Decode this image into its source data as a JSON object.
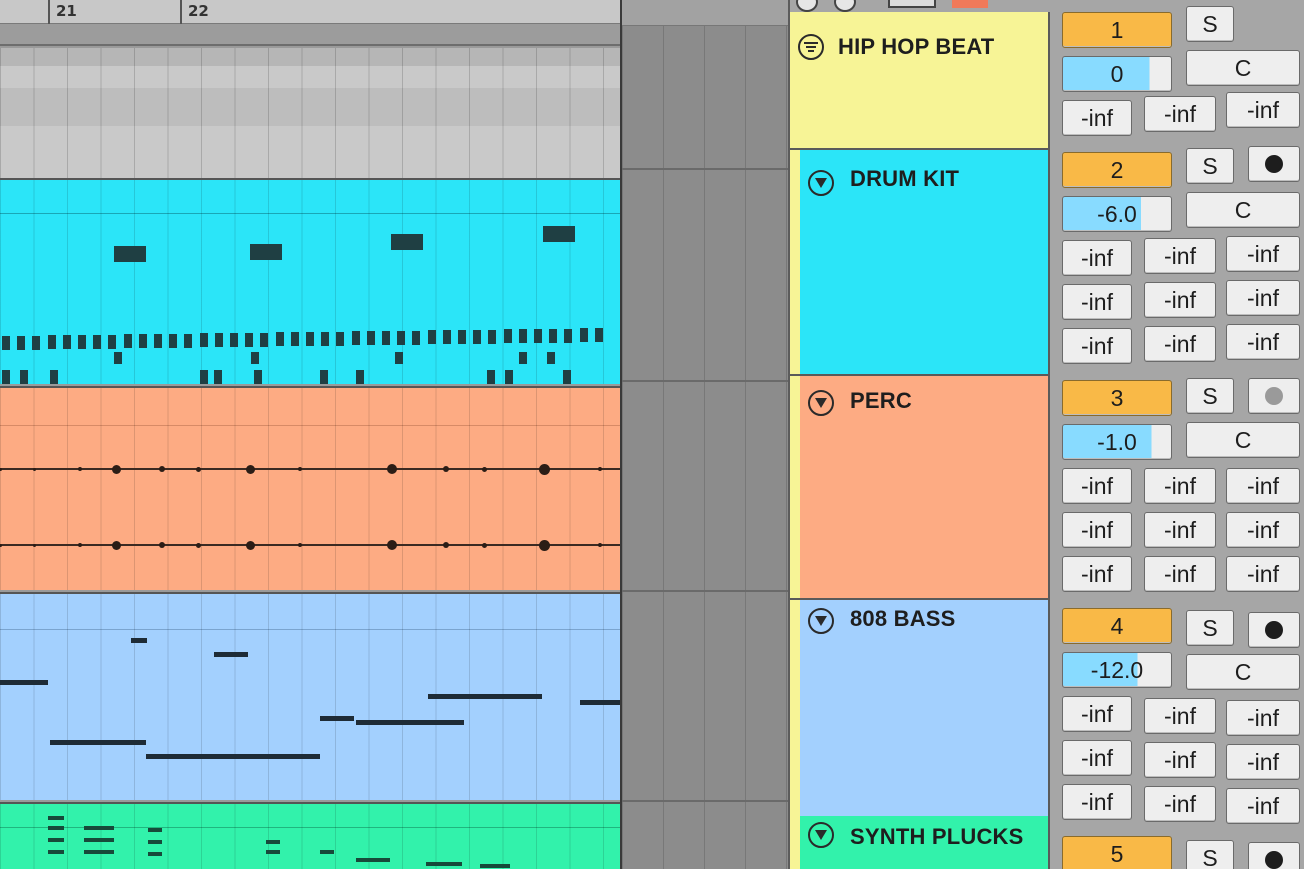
{
  "ruler": {
    "bar_a": "21",
    "bar_b": "22"
  },
  "tracks": [
    {
      "name": "HIP HOP BEAT",
      "kind": "group",
      "color": "#f7f496",
      "number": "1",
      "solo": "S",
      "volume": "0",
      "volume_fill": 0.9,
      "pan": "C",
      "sends": [
        "-inf",
        "-inf",
        "-inf"
      ],
      "icon": "group-collapse-icon"
    },
    {
      "name": "DRUM KIT",
      "kind": "audio",
      "color": "#2be5f8",
      "number": "2",
      "solo": "S",
      "record_icon": "monitor-icon",
      "volume": "-6.0",
      "volume_fill": 0.72,
      "pan": "C",
      "sends": [
        "-inf",
        "-inf",
        "-inf",
        "-inf",
        "-inf",
        "-inf",
        "-inf",
        "-inf",
        "-inf"
      ],
      "icon": "fold-arrow-icon"
    },
    {
      "name": "PERC",
      "kind": "audio",
      "color": "#fdab83",
      "number": "3",
      "solo": "S",
      "record_icon": "arm-record-icon",
      "volume": "-1.0",
      "volume_fill": 0.82,
      "pan": "C",
      "sends": [
        "-inf",
        "-inf",
        "-inf",
        "-inf",
        "-inf",
        "-inf",
        "-inf",
        "-inf",
        "-inf"
      ],
      "icon": "fold-arrow-icon"
    },
    {
      "name": "808 BASS",
      "kind": "midi",
      "color": "#a3d0fe",
      "number": "4",
      "solo": "S",
      "record_icon": "monitor-icon",
      "volume": "-12.0",
      "volume_fill": 0.69,
      "pan": "C",
      "sends": [
        "-inf",
        "-inf",
        "-inf",
        "-inf",
        "-inf",
        "-inf",
        "-inf",
        "-inf",
        "-inf"
      ],
      "icon": "fold-arrow-icon"
    },
    {
      "name": "SYNTH PLUCKS",
      "kind": "midi",
      "color": "#32f2ab",
      "number": "5",
      "solo": "S",
      "record_icon": "monitor-icon",
      "icon": "fold-arrow-icon"
    }
  ]
}
